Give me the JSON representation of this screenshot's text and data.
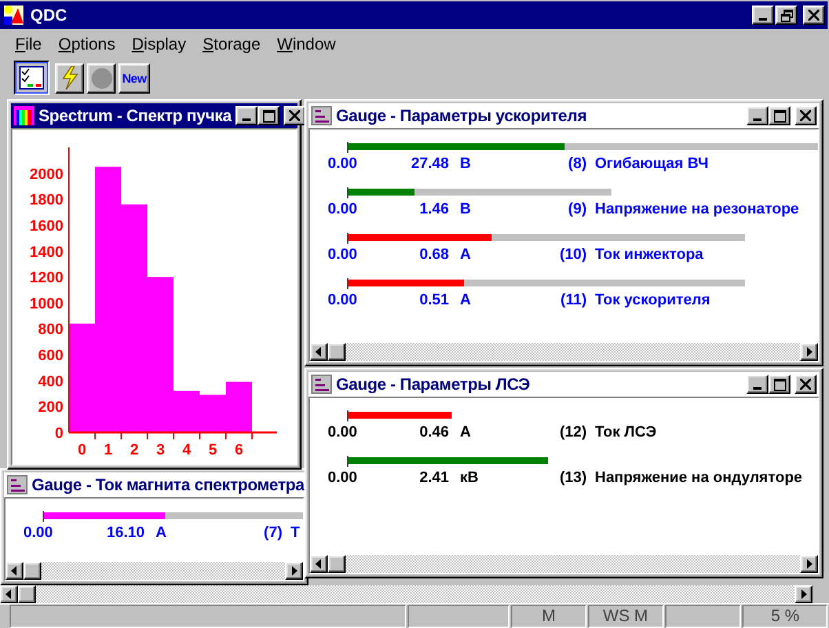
{
  "window": {
    "title": "QDC"
  },
  "menu": [
    {
      "label": "File"
    },
    {
      "label": "Options"
    },
    {
      "label": "Display"
    },
    {
      "label": "Storage"
    },
    {
      "label": "Window"
    }
  ],
  "toolbar": [
    {
      "kind": "checklist",
      "pressed": true
    },
    {
      "kind": "lightning",
      "pressed": false
    },
    {
      "kind": "record",
      "pressed": false
    },
    {
      "kind": "text",
      "label": "New",
      "pressed": false
    }
  ],
  "windows": [
    {
      "kind": "chart",
      "title": "Spectrum - Спектр пучка",
      "active": true,
      "chart_data": {
        "type": "bar",
        "categories": [
          "0",
          "1",
          "2",
          "3",
          "4",
          "5",
          "6"
        ],
        "series": [
          {
            "color": "#ff00ff",
            "values": [
              840,
              2050,
              1760,
              1200,
              320,
              290,
              390
            ]
          }
        ],
        "ylim": [
          0,
          2200
        ],
        "yticks": [
          0,
          200,
          400,
          600,
          800,
          1000,
          1200,
          1400,
          1600,
          1800,
          2000
        ]
      }
    },
    {
      "kind": "gauges",
      "title": "Gauge - Параметры ускорителя",
      "active": false,
      "gauges": [
        {
          "min": "0.00",
          "value": "27.48",
          "unit": "В",
          "index": "(8)",
          "name": "Огибающая ВЧ",
          "level": 0.46,
          "color": "#008000"
        },
        {
          "min": "0.00",
          "value": "1.46",
          "unit": "В",
          "index": "(9)",
          "name": "Напряжение на резонаторе",
          "level": 0.25,
          "color": "#008000"
        },
        {
          "min": "0.00",
          "value": "0.68",
          "unit": "А",
          "index": "(10)",
          "name": "Ток инжектора",
          "level": 0.36,
          "color": "#ff0000"
        },
        {
          "min": "0.00",
          "value": "0.51",
          "unit": "А",
          "index": "(11)",
          "name": "Ток ускорителя",
          "level": 0.29,
          "color": "#ff0000"
        }
      ]
    },
    {
      "kind": "gauges",
      "title": "Gauge - Параметры ЛСЭ",
      "active": false,
      "gauges": [
        {
          "min": "0.00",
          "value": "0.46",
          "unit": "А",
          "index": "(12)",
          "name": "Ток ЛСЭ",
          "level": 1,
          "color": "#ff0000"
        },
        {
          "min": "0.00",
          "value": "2.41",
          "unit": "кВ",
          "index": "(13)",
          "name": "Напряжение на ондуляторе",
          "level": 1,
          "color": "#008000"
        }
      ]
    },
    {
      "kind": "gauges",
      "title": "Gauge - Ток магнита спектрометра",
      "active": false,
      "gauges": [
        {
          "min": "0.00",
          "value": "16.10",
          "unit": "А",
          "index": "(7)",
          "name": "Т",
          "level": 0.47,
          "color": "#ff00ff"
        }
      ]
    }
  ],
  "status_bar": {
    "panes": [
      "M",
      "WS M",
      "5 %"
    ]
  }
}
